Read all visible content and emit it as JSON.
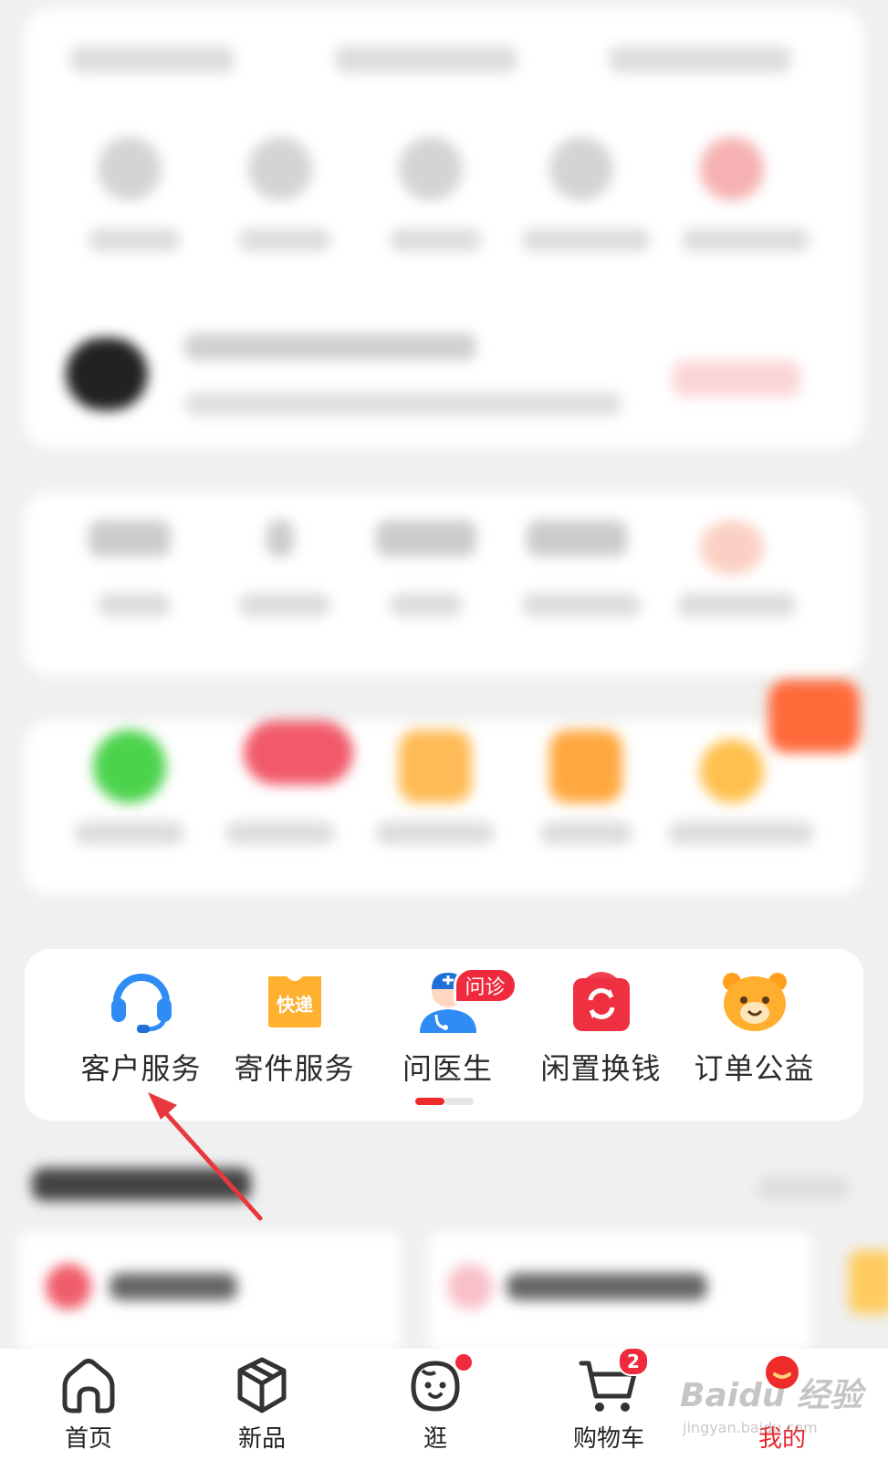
{
  "services": {
    "items": [
      {
        "label": "客户服务",
        "icon": "headset-icon"
      },
      {
        "label": "寄件服务",
        "icon": "express-box-icon",
        "icon_text": "快递"
      },
      {
        "label": "问医生",
        "icon": "doctor-icon",
        "tag": "问诊"
      },
      {
        "label": "闲置换钱",
        "icon": "recycle-bag-icon"
      },
      {
        "label": "订单公益",
        "icon": "bear-icon"
      }
    ],
    "page_indicator": {
      "active": 1,
      "total": 2
    }
  },
  "tabbar": {
    "items": [
      {
        "label": "首页",
        "icon": "home-icon"
      },
      {
        "label": "新品",
        "icon": "cube-icon"
      },
      {
        "label": "逛",
        "icon": "face-icon",
        "dot": true
      },
      {
        "label": "购物车",
        "icon": "cart-icon",
        "badge": "2"
      },
      {
        "label": "我的",
        "icon": "profile-icon",
        "active": true
      }
    ]
  },
  "watermark": {
    "text": "Baidu 经验",
    "sub": "jingyan.baidu.com"
  },
  "colors": {
    "accent": "#e8262d",
    "badge": "#ee2a3c",
    "blue": "#2f8cf5",
    "orange": "#ffae2e"
  }
}
